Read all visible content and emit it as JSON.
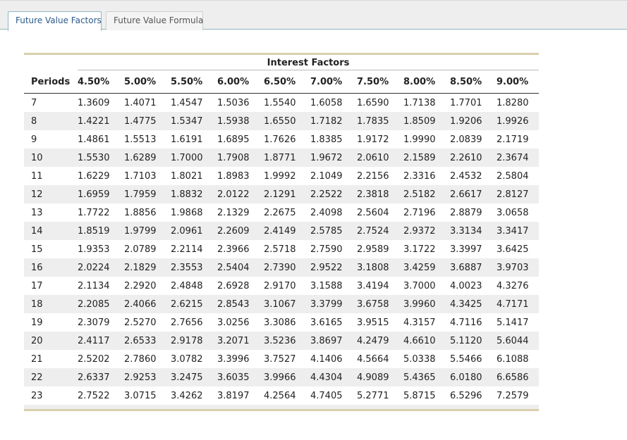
{
  "tabs": [
    {
      "label": "Future Value Factors",
      "active": true
    },
    {
      "label": "Future Value Formula",
      "active": false
    }
  ],
  "table": {
    "super_header": "Interest Factors",
    "period_header": "Periods",
    "rate_headers": [
      "4.50%",
      "5.00%",
      "5.50%",
      "6.00%",
      "6.50%",
      "7.00%",
      "7.50%",
      "8.00%",
      "8.50%",
      "9.00%"
    ],
    "rows": [
      {
        "period": "7",
        "values": [
          "1.3609",
          "1.4071",
          "1.4547",
          "1.5036",
          "1.5540",
          "1.6058",
          "1.6590",
          "1.7138",
          "1.7701",
          "1.8280"
        ]
      },
      {
        "period": "8",
        "values": [
          "1.4221",
          "1.4775",
          "1.5347",
          "1.5938",
          "1.6550",
          "1.7182",
          "1.7835",
          "1.8509",
          "1.9206",
          "1.9926"
        ]
      },
      {
        "period": "9",
        "values": [
          "1.4861",
          "1.5513",
          "1.6191",
          "1.6895",
          "1.7626",
          "1.8385",
          "1.9172",
          "1.9990",
          "2.0839",
          "2.1719"
        ]
      },
      {
        "period": "10",
        "values": [
          "1.5530",
          "1.6289",
          "1.7000",
          "1.7908",
          "1.8771",
          "1.9672",
          "2.0610",
          "2.1589",
          "2.2610",
          "2.3674"
        ]
      },
      {
        "period": "11",
        "values": [
          "1.6229",
          "1.7103",
          "1.8021",
          "1.8983",
          "1.9992",
          "2.1049",
          "2.2156",
          "2.3316",
          "2.4532",
          "2.5804"
        ]
      },
      {
        "period": "12",
        "values": [
          "1.6959",
          "1.7959",
          "1.8832",
          "2.0122",
          "2.1291",
          "2.2522",
          "2.3818",
          "2.5182",
          "2.6617",
          "2.8127"
        ]
      },
      {
        "period": "13",
        "values": [
          "1.7722",
          "1.8856",
          "1.9868",
          "2.1329",
          "2.2675",
          "2.4098",
          "2.5604",
          "2.7196",
          "2.8879",
          "3.0658"
        ]
      },
      {
        "period": "14",
        "values": [
          "1.8519",
          "1.9799",
          "2.0961",
          "2.2609",
          "2.4149",
          "2.5785",
          "2.7524",
          "2.9372",
          "3.3134",
          "3.3417"
        ]
      },
      {
        "period": "15",
        "values": [
          "1.9353",
          "2.0789",
          "2.2114",
          "2.3966",
          "2.5718",
          "2.7590",
          "2.9589",
          "3.1722",
          "3.3997",
          "3.6425"
        ]
      },
      {
        "period": "16",
        "values": [
          "2.0224",
          "2.1829",
          "2.3553",
          "2.5404",
          "2.7390",
          "2.9522",
          "3.1808",
          "3.4259",
          "3.6887",
          "3.9703"
        ]
      },
      {
        "period": "17",
        "values": [
          "2.1134",
          "2.2920",
          "2.4848",
          "2.6928",
          "2.9170",
          "3.1588",
          "3.4194",
          "3.7000",
          "4.0023",
          "4.3276"
        ]
      },
      {
        "period": "18",
        "values": [
          "2.2085",
          "2.4066",
          "2.6215",
          "2.8543",
          "3.1067",
          "3.3799",
          "3.6758",
          "3.9960",
          "4.3425",
          "4.7171"
        ]
      },
      {
        "period": "19",
        "values": [
          "2.3079",
          "2.5270",
          "2.7656",
          "3.0256",
          "3.3086",
          "3.6165",
          "3.9515",
          "4.3157",
          "4.7116",
          "5.1417"
        ]
      },
      {
        "period": "20",
        "values": [
          "2.4117",
          "2.6533",
          "2.9178",
          "3.2071",
          "3.5236",
          "3.8697",
          "4.2479",
          "4.6610",
          "5.1120",
          "5.6044"
        ]
      },
      {
        "period": "21",
        "values": [
          "2.5202",
          "2.7860",
          "3.0782",
          "3.3996",
          "3.7527",
          "4.1406",
          "4.5664",
          "5.0338",
          "5.5466",
          "6.1088"
        ]
      },
      {
        "period": "22",
        "values": [
          "2.6337",
          "2.9253",
          "3.2475",
          "3.6035",
          "3.9966",
          "4.4304",
          "4.9089",
          "5.4365",
          "6.0180",
          "6.6586"
        ]
      },
      {
        "period": "23",
        "values": [
          "2.7522",
          "3.0715",
          "3.4262",
          "3.8197",
          "4.2564",
          "4.7405",
          "5.2771",
          "5.8715",
          "6.5296",
          "7.2579"
        ]
      }
    ]
  },
  "colors": {
    "tab_border": "#8fb7c0",
    "rule": "#d9cfae",
    "stripe": "#eeeeee"
  }
}
